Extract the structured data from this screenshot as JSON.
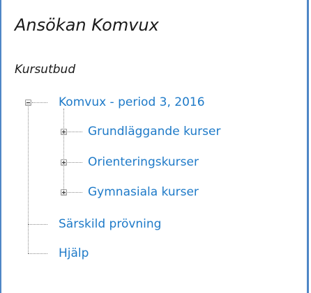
{
  "header": {
    "title": "Ansökan Komvux",
    "subtitle": "Kursutbud"
  },
  "tree": {
    "root": {
      "label": "Komvux - period 3, 2016",
      "state": "expanded",
      "children": [
        {
          "label": "Grundläggande kurser",
          "state": "collapsed"
        },
        {
          "label": "Orienteringskurser",
          "state": "collapsed"
        },
        {
          "label": "Gymnasiala kurser",
          "state": "collapsed"
        }
      ]
    },
    "siblings": [
      {
        "label": "Särskild prövning"
      },
      {
        "label": "Hjälp"
      }
    ]
  },
  "colors": {
    "link": "#1e7ac8",
    "frame": "#4f86c6",
    "tree_line": "#8a8a8a"
  }
}
